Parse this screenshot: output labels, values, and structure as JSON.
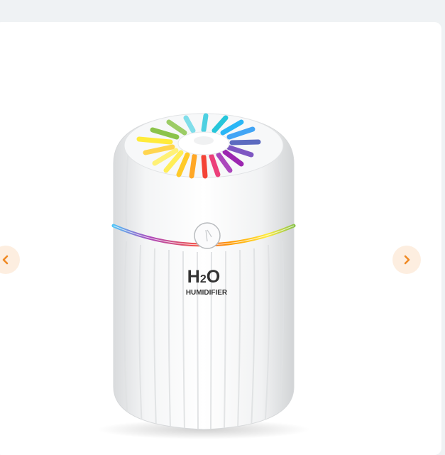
{
  "gallery": {
    "product_brand_main": "H",
    "product_brand_sub": "2",
    "product_brand_end": "O",
    "product_label": "HUMIDIFIER",
    "prev_icon": "chevron-left-icon",
    "next_icon": "chevron-right-icon",
    "accent_color": "#f08a24",
    "nav_bg_color": "#fdeee0"
  }
}
